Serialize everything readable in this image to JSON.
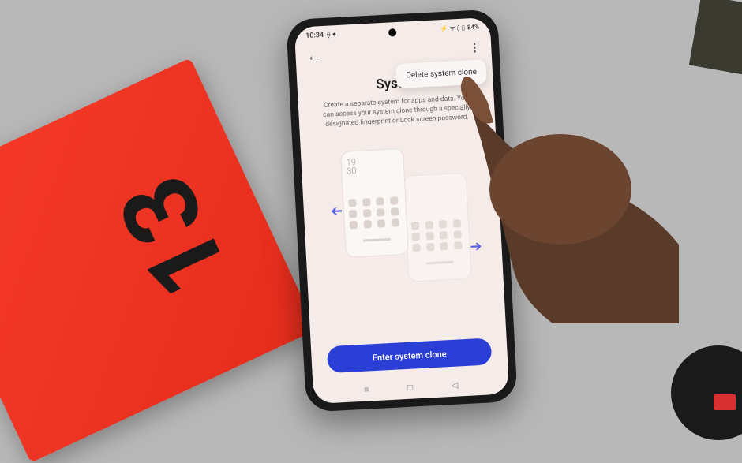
{
  "statusbar": {
    "time": "10:34",
    "icons_left": "⟠ ●",
    "icons_right": "⚡ ᯤ ⟠ ▯",
    "battery": "84%"
  },
  "header": {
    "back": "←",
    "more": "⋮"
  },
  "dropdown": {
    "delete": "Delete system clone"
  },
  "page": {
    "title_truncated": "Syster",
    "title_full": "System Clone",
    "description": "Create a separate system for apps and data. You can access your system clone through a specially designated fingerprint or Lock screen password."
  },
  "illustration": {
    "time": "19\n30"
  },
  "button": {
    "primary": "Enter system clone"
  },
  "navbar": {
    "recent": "≡",
    "home": "□",
    "back": "◁"
  },
  "box": {
    "label": "13"
  }
}
